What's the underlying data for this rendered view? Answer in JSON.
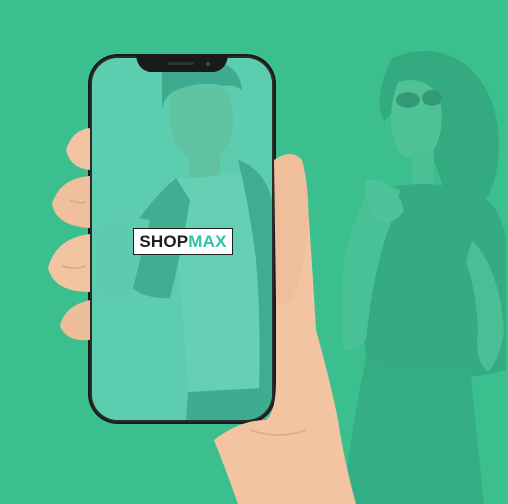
{
  "logo": {
    "part1": "SHOP",
    "part2": "MAX"
  },
  "colors": {
    "background": "#3cbf8e",
    "screen_overlay": "#45c8a6",
    "logo_accent": "#2ec5a0",
    "logo_dark": "#1f1f1f",
    "phone_frame": "#1a1a1a",
    "skin": "#f2c4a2"
  }
}
